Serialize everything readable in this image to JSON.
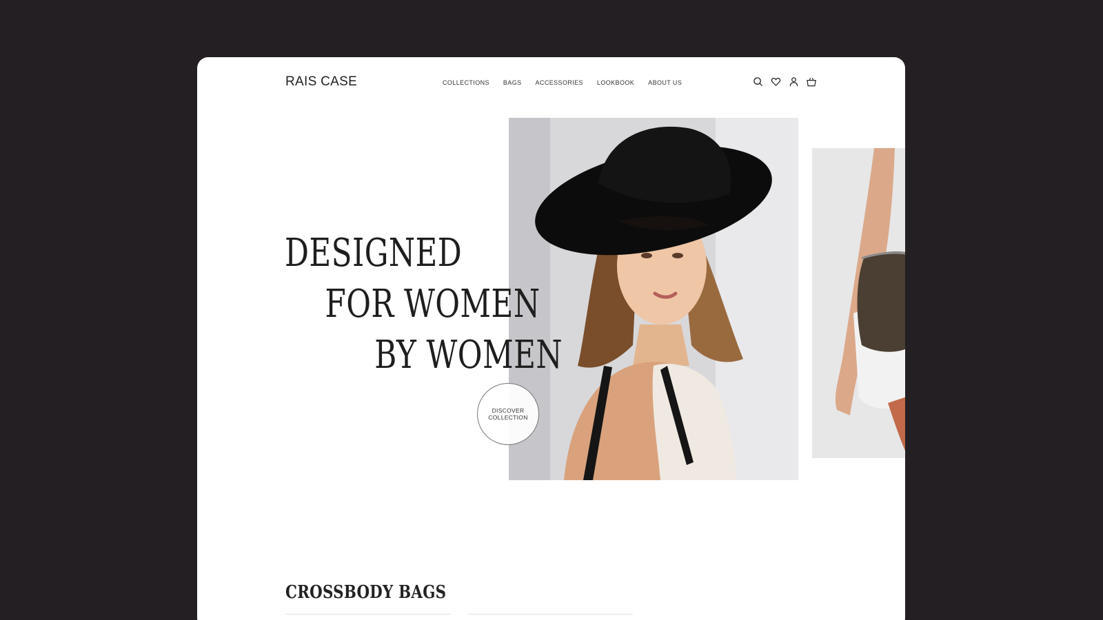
{
  "brand": {
    "logo": "RAIS CASE"
  },
  "nav": {
    "items": [
      "COLLECTIONS",
      "BAGS",
      "ACCESSORIES",
      "LOOKBOOK",
      "ABOUT US"
    ]
  },
  "header_icons": [
    "search-icon",
    "heart-icon",
    "user-icon",
    "cart-icon"
  ],
  "hero": {
    "headline_line1": "DESIGNED",
    "headline_line2": "FOR WOMEN",
    "headline_line3": "BY WOMEN",
    "cta_line1": "DISCOVER",
    "cta_line2": "COLLECTION"
  },
  "sections": {
    "crossbody_title": "CROSSBODY BAGS"
  },
  "colors": {
    "background": "#231f22",
    "card": "#ffffff",
    "text": "#1e1e1e"
  }
}
